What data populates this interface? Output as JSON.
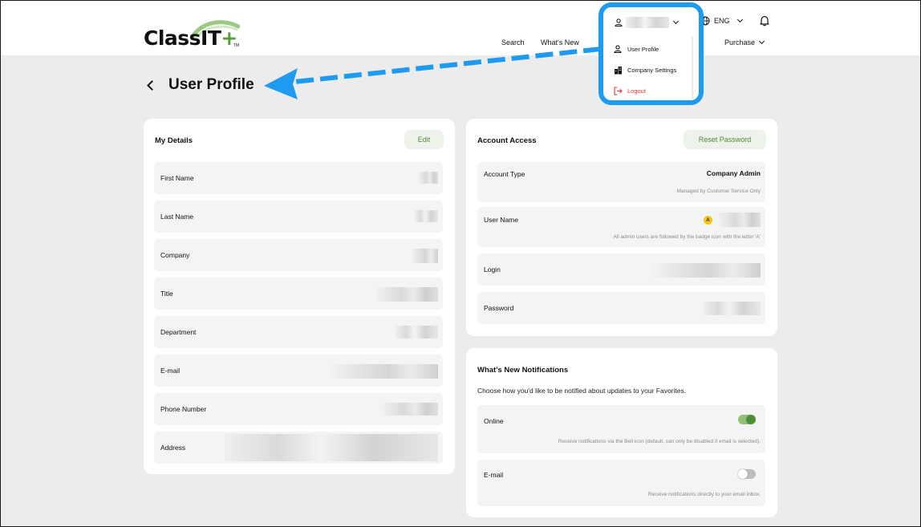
{
  "brand": {
    "name_main": "ClassIT",
    "name_plus": "+",
    "trademark": "TM",
    "accent": "#5a9b3a"
  },
  "nav": {
    "search": "Search",
    "whats_new": "What's New",
    "purchase": "Purchase",
    "language": "ENG",
    "bell_icon": "bell-icon"
  },
  "user_menu": {
    "highlight_color": "#1e9bf0",
    "items": [
      {
        "label": "User Profile",
        "icon": "user-icon"
      },
      {
        "label": "Company Settings",
        "icon": "building-icon"
      },
      {
        "label": "Logout",
        "icon": "logout-icon",
        "color": "#e53935"
      }
    ]
  },
  "page": {
    "title": "User Profile"
  },
  "my_details": {
    "title": "My Details",
    "edit_label": "Edit",
    "fields": [
      {
        "label": "First Name"
      },
      {
        "label": "Last Name"
      },
      {
        "label": "Company"
      },
      {
        "label": "Title"
      },
      {
        "label": "Department"
      },
      {
        "label": "E-mail"
      },
      {
        "label": "Phone Number"
      },
      {
        "label": "Address"
      }
    ]
  },
  "account_access": {
    "title": "Account Access",
    "reset_label": "Reset Password",
    "account_type": {
      "label": "Account Type",
      "value": "Company Admin",
      "note": "Managed by Customer Service Only"
    },
    "user_name": {
      "label": "User Name",
      "badge": "A",
      "note": "All admin users are followed by the badge icon with the letter 'A'"
    },
    "login": {
      "label": "Login"
    },
    "password": {
      "label": "Password"
    }
  },
  "notifications": {
    "title": "What's New Notifications",
    "description": "Choose how you'd like to be notified about updates to your Favorites.",
    "online": {
      "label": "Online",
      "note": "Receive notifications via the Bell icon (default, can only be disabled if email is selected).",
      "enabled": true
    },
    "email": {
      "label": "E-mail",
      "note": "Receive notifications directly to your email inbox.",
      "enabled": false
    }
  }
}
